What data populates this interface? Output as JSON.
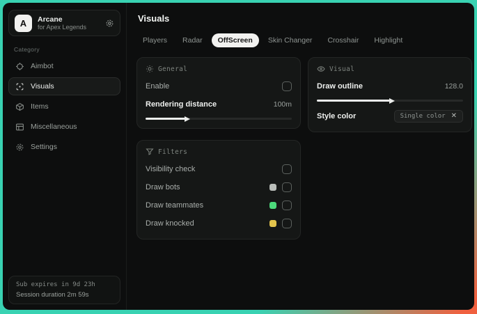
{
  "frame": {
    "gradient_start": "#39d2b2",
    "gradient_end": "#f0603f",
    "window_bg": "#0d0e0e"
  },
  "sidebar": {
    "app": {
      "logo_letter": "A",
      "name": "Arcane",
      "subtitle": "for Apex Legends"
    },
    "category_label": "Category",
    "items": [
      {
        "label": "Aimbot",
        "selected": false
      },
      {
        "label": "Visuals",
        "selected": true
      },
      {
        "label": "Items",
        "selected": false
      },
      {
        "label": "Miscellaneous",
        "selected": false
      },
      {
        "label": "Settings",
        "selected": false
      }
    ],
    "footer": {
      "sub_expires": "Sub expires in 9d 23h",
      "session_duration": "Session duration 2m 59s"
    }
  },
  "main": {
    "title": "Visuals",
    "tabs": [
      {
        "label": "Players",
        "selected": false
      },
      {
        "label": "Radar",
        "selected": false
      },
      {
        "label": "OffScreen",
        "selected": true
      },
      {
        "label": "Skin Changer",
        "selected": false
      },
      {
        "label": "Crosshair",
        "selected": false
      },
      {
        "label": "Highlight",
        "selected": false
      }
    ],
    "general": {
      "header": "General",
      "enable_label": "Enable",
      "enable_checked": false,
      "rendering_distance_label": "Rendering distance",
      "rendering_distance_value": "100m",
      "slider_percent": "27"
    },
    "visual": {
      "header": "Visual",
      "draw_outline_label": "Draw outline",
      "draw_outline_value": "128.0",
      "slider_percent": "50",
      "style_color_label": "Style color",
      "style_color_value": "Single color"
    },
    "filters": {
      "header": "Filters",
      "rows": [
        {
          "label": "Visibility check",
          "swatch": "",
          "checked": false
        },
        {
          "label": "Draw bots",
          "swatch": "#b9bdb9",
          "checked": false
        },
        {
          "label": "Draw teammates",
          "swatch": "#4cd97b",
          "checked": false
        },
        {
          "label": "Draw knocked",
          "swatch": "#e3c44c",
          "checked": false
        }
      ]
    }
  }
}
